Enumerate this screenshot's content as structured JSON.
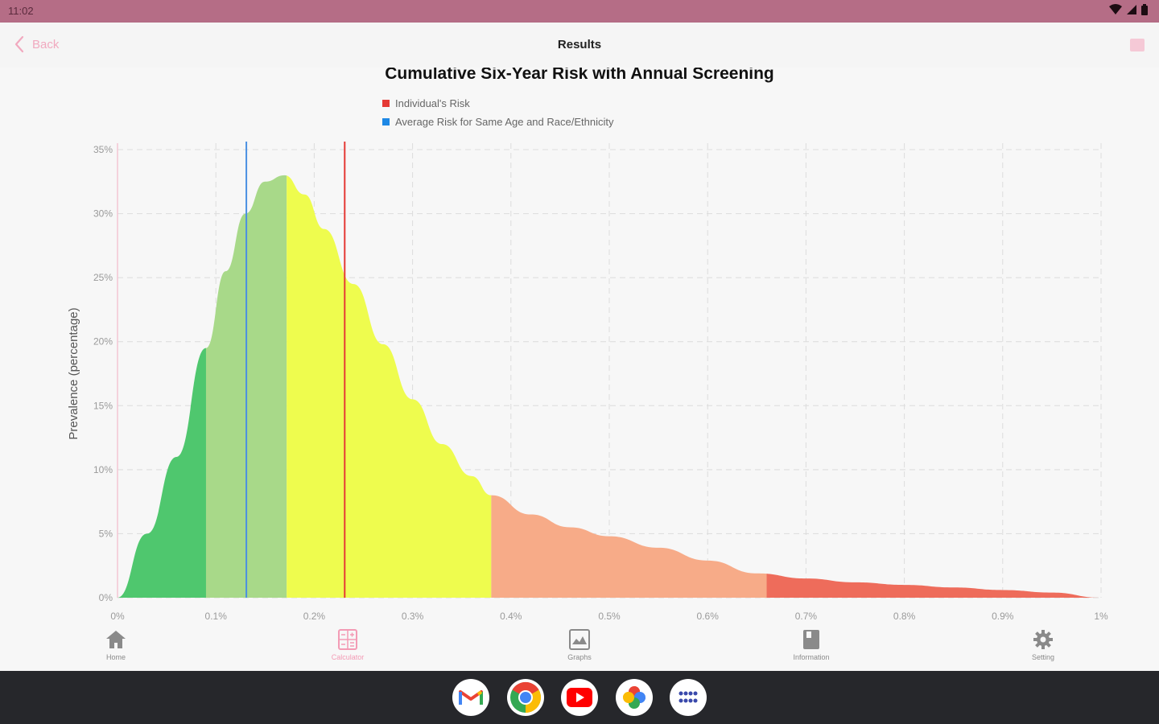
{
  "status_bar": {
    "time": "11:02",
    "icons": [
      "wifi-icon",
      "signal-icon",
      "battery-icon"
    ]
  },
  "app_bar": {
    "back_label": "Back",
    "title": "Results",
    "menu_icon": "menu-icon"
  },
  "chart_data": {
    "type": "area",
    "title": "Cumulative Six-Year Risk with Annual Screening",
    "ylabel": "Prevalence (percentage)",
    "xlabel": "",
    "xlim": [
      0,
      1
    ],
    "ylim": [
      0,
      35
    ],
    "x_tick_labels": [
      "0%",
      "0.1%",
      "0.2%",
      "0.3%",
      "0.4%",
      "0.5%",
      "0.6%",
      "0.7%",
      "0.8%",
      "0.9%",
      "1%"
    ],
    "y_tick_labels": [
      "0%",
      "5%",
      "10%",
      "15%",
      "20%",
      "25%",
      "30%",
      "35%"
    ],
    "grid": true,
    "legend": [
      {
        "label": "Individual's Risk",
        "color": "#e53935"
      },
      {
        "label": "Average Risk for Same Age and Race/Ethnicity",
        "color": "#1e88e5"
      }
    ],
    "curve": {
      "x": [
        0.0,
        0.03,
        0.06,
        0.09,
        0.11,
        0.13,
        0.15,
        0.17,
        0.19,
        0.21,
        0.24,
        0.27,
        0.3,
        0.33,
        0.36,
        0.38,
        0.42,
        0.46,
        0.5,
        0.55,
        0.6,
        0.65,
        0.7,
        0.75,
        0.8,
        0.85,
        0.9,
        0.95,
        1.0
      ],
      "y": [
        0.0,
        5.0,
        11.0,
        19.5,
        25.5,
        30.0,
        32.5,
        33.0,
        31.5,
        28.8,
        24.5,
        19.8,
        15.5,
        12.0,
        9.5,
        8.0,
        6.5,
        5.5,
        4.8,
        3.9,
        2.9,
        1.9,
        1.5,
        1.2,
        1.0,
        0.8,
        0.6,
        0.4,
        0.0
      ]
    },
    "bands": [
      {
        "from": 0.0,
        "to": 0.09,
        "color": "#4fc76e"
      },
      {
        "from": 0.09,
        "to": 0.172,
        "color": "#a8d989"
      },
      {
        "from": 0.172,
        "to": 0.38,
        "color": "#eefc4e"
      },
      {
        "from": 0.38,
        "to": 0.66,
        "color": "#f7ab88"
      },
      {
        "from": 0.66,
        "to": 1.0,
        "color": "#ee6c5b"
      }
    ],
    "markers": [
      {
        "name": "Average Risk for Same Age and Race/Ethnicity",
        "x": 0.131,
        "color": "#4a90e2"
      },
      {
        "name": "Individual's Risk",
        "x": 0.231,
        "color": "#e53935"
      }
    ]
  },
  "bottom_nav": {
    "items": [
      {
        "label": "Home",
        "icon": "home-icon",
        "active": false
      },
      {
        "label": "Calculator",
        "icon": "calculator-icon",
        "active": true
      },
      {
        "label": "Graphs",
        "icon": "graph-icon",
        "active": false
      },
      {
        "label": "Information",
        "icon": "book-icon",
        "active": false
      },
      {
        "label": "Setting",
        "icon": "gear-icon",
        "active": false
      }
    ]
  },
  "dock": {
    "apps": [
      "gmail-icon",
      "chrome-icon",
      "youtube-icon",
      "photos-icon",
      "app-drawer-icon"
    ]
  },
  "colors": {
    "status_bar": "#b56d86",
    "accent": "#f39bb5",
    "dock": "#26272b"
  }
}
